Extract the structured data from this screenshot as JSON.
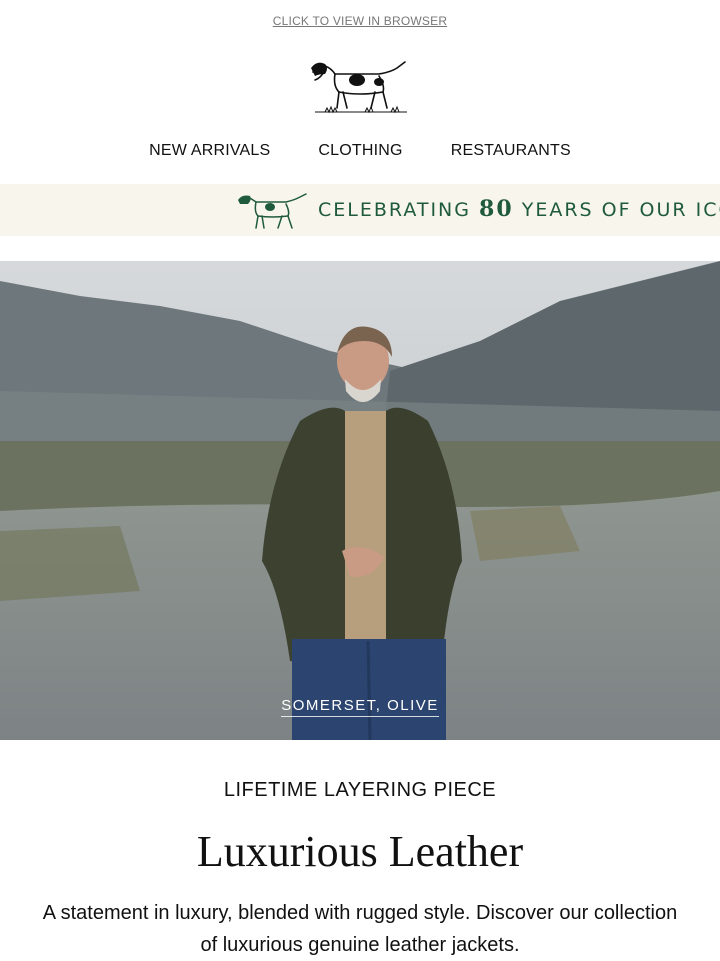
{
  "header": {
    "view_in_browser": "CLICK TO VIEW IN BROWSER"
  },
  "logo": {
    "icon": "pointer-dog-icon"
  },
  "nav": {
    "items": [
      "NEW ARRIVALS",
      "CLOTHING",
      "RESTAURANTS"
    ]
  },
  "banner": {
    "icon": "pointer-dog-icon",
    "text_before": "CELEBRATING ",
    "number": "80",
    "text_after": " YEARS OF OUR ICONIC",
    "color": "#1f5a3c"
  },
  "hero": {
    "caption": "SOMERSET, OLIVE"
  },
  "content": {
    "eyebrow": "LIFETIME LAYERING PIECE",
    "headline": "Luxurious Leather",
    "body": "A statement in luxury, blended with rugged style. Discover our collection of luxurious genuine leather jackets."
  }
}
